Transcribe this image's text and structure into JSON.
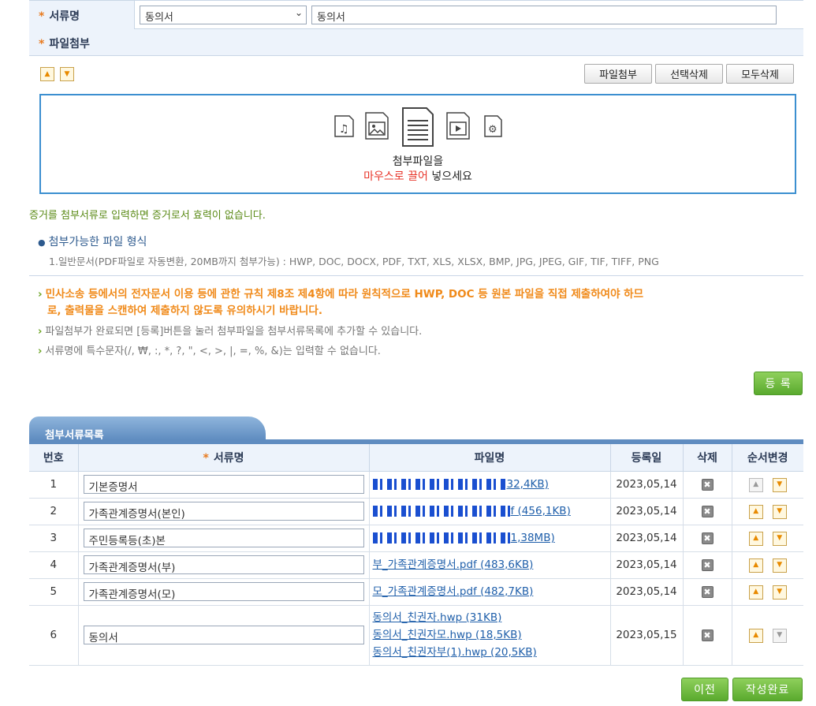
{
  "form": {
    "doc_name_label": "서류명",
    "doc_select_value": "동의서",
    "doc_text_value": "동의서",
    "attach_label": "파일첨부"
  },
  "toolbar": {
    "attach_btn": "파일첨부",
    "delete_selected_btn": "선택삭제",
    "delete_all_btn": "모두삭제"
  },
  "dropzone": {
    "line1": "첨부파일을",
    "line2_red": "마우스로 끌어",
    "line2_rest": " 넣으세요"
  },
  "notices": {
    "warning_green": "증거를 첨부서류로 입력하면 증거로서 효력이 없습니다.",
    "formats_title": "첨부가능한 파일 형식",
    "formats_detail": "1.일반문서(PDF파일로 자동변환, 20MB까지 첨부가능) : HWP, DOC, DOCX, PDF, TXT, XLS, XLSX, BMP, JPG, JPEG, GIF, TIF, TIFF, PNG",
    "rule_line1": "민사소송 등에서의 전자문서 이용 등에 관한 규칙 제8조 제4항에 따라 원칙적으로 HWP, DOC 등 원본 파일을 직접 제출하여야 하므",
    "rule_line2": "로, 출력물을 스캔하여 제출하지 않도록 유의하시기 바랍니다.",
    "register_note": "파일첨부가 완료되면 [등록]버튼을 눌러 첨부파일을 첨부서류목록에 추가할 수 있습니다.",
    "special_chars_note": "서류명에 특수문자(/, ₩, :, *, ?, \", <, >, |, =, %, &)는 입력할 수 없습니다."
  },
  "register_btn": "등 록",
  "list": {
    "tab_title": "첨부서류목록",
    "headers": [
      "번호",
      "서류명",
      "파일명",
      "등록일",
      "삭제",
      "순서변경"
    ],
    "rows": [
      {
        "no": "1",
        "name": "기본증명서",
        "files": [
          "32,4KB)"
        ],
        "date": "2023,05,14"
      },
      {
        "no": "2",
        "name": "가족관계증명서(본인)",
        "files": [
          "f (456,1KB)"
        ],
        "date": "2023,05,14"
      },
      {
        "no": "3",
        "name": "주민등록등(초)본",
        "files": [
          "1,38MB)"
        ],
        "date": "2023,05,14"
      },
      {
        "no": "4",
        "name": "가족관계증명서(부)",
        "files": [
          "부_가족관계증명서.pdf (483,6KB)"
        ],
        "date": "2023,05,14"
      },
      {
        "no": "5",
        "name": "가족관계증명서(모)",
        "files": [
          "모_가족관계증명서.pdf (482,7KB)"
        ],
        "date": "2023,05,14"
      },
      {
        "no": "6",
        "name": "동의서",
        "files": [
          "동의서_친권자.hwp (31KB)",
          "동의서_친권자모.hwp (18,5KB)",
          "동의서_친권자부(1).hwp (20,5KB)"
        ],
        "date": "2023,05,15"
      }
    ]
  },
  "footer": {
    "prev_btn": "이전",
    "complete_btn": "작성완료"
  },
  "colors": {
    "accent_blue": "#3c8fd0",
    "header_bg": "#edf3fb",
    "green_button": "#5aaa2e",
    "orange_text": "#f08a1a",
    "link": "#1f5faa"
  }
}
